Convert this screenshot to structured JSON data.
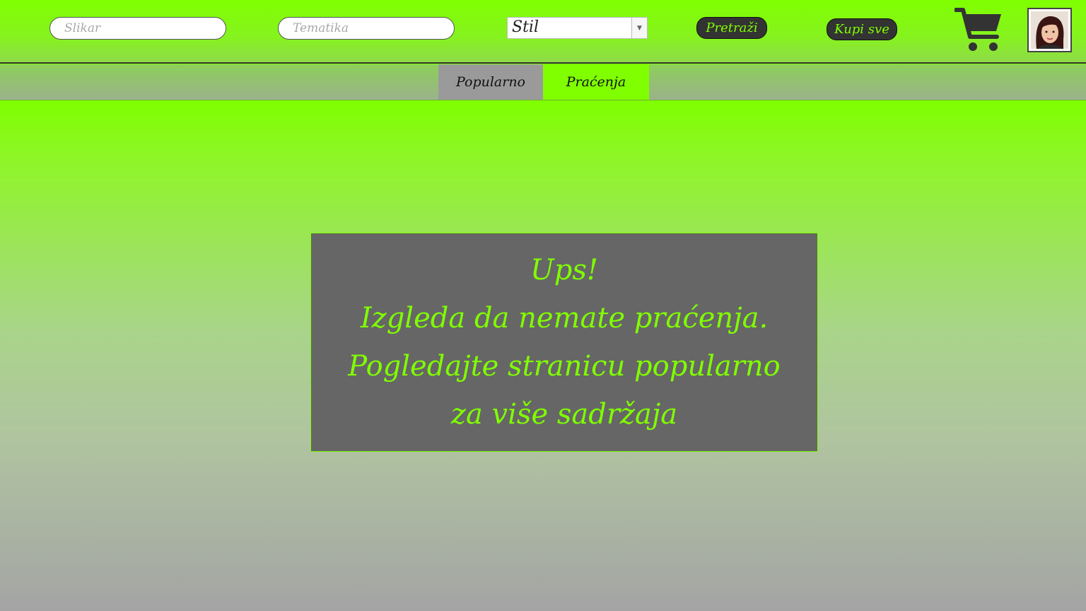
{
  "header": {
    "painter_placeholder": "Slikar",
    "theme_placeholder": "Tematika",
    "style_select_value": "Stil",
    "search_label": "Pretraži",
    "buy_all_label": "Kupi sve",
    "cart_icon": "shopping-cart-icon",
    "avatar_icon": "user-avatar"
  },
  "tabs": [
    {
      "label": "Popularno",
      "active": false
    },
    {
      "label": "Praćenja",
      "active": true
    }
  ],
  "message": {
    "line1": "Ups!",
    "line2": "Izgleda da nemate praćenja.",
    "line3": "Pogledajte stranicu popularno",
    "line4": "za više sadržaja"
  },
  "colors": {
    "accent": "#7fff00",
    "dark": "#333333",
    "message_bg": "#666666",
    "inactive_tab": "#9a9a9a"
  }
}
